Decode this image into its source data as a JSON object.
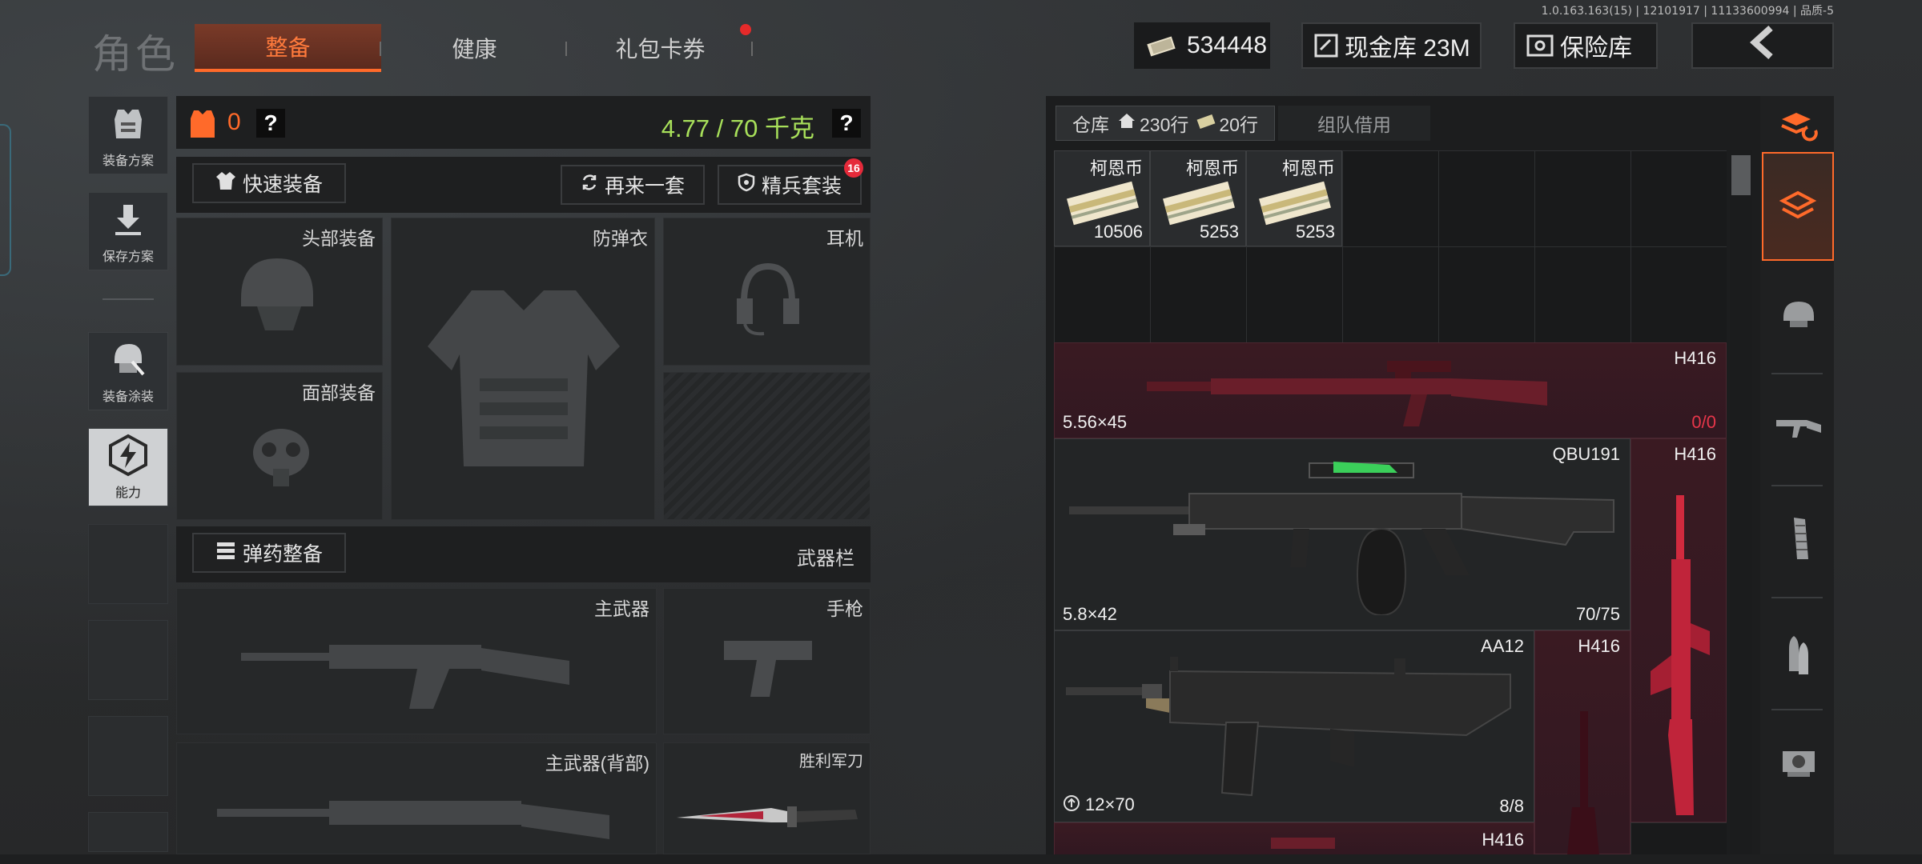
{
  "version": "1.0.163.163(15) | 12101917 | 11133600994 | 品质-5",
  "header": {
    "title": "角色",
    "tabs": [
      {
        "label": "整备",
        "active": true
      },
      {
        "label": "健康",
        "active": false
      },
      {
        "label": "礼包卡券",
        "active": false,
        "badge": true
      }
    ],
    "currency": "534448",
    "cash_vault": "现金库 23M",
    "safe": "保险库"
  },
  "left_nav": [
    {
      "label": "装备方案",
      "icon": "vest-icon"
    },
    {
      "label": "保存方案",
      "icon": "download-icon"
    },
    {
      "label": "装备涂装",
      "icon": "helmet-paint-icon"
    },
    {
      "label": "能力",
      "icon": "ability-icon"
    }
  ],
  "loadout": {
    "armor_count": "0",
    "weight": "4.77 / 70 千克",
    "quick_equip": "快速装备",
    "reroll": "再来一套",
    "elite_set": "精兵套装",
    "elite_badge": "16",
    "slots": {
      "head": "头部装备",
      "vest": "防弹衣",
      "headset": "耳机",
      "face": "面部装备",
      "ammo_btn": "弹药整备",
      "weapon_bar": "武器栏",
      "primary": "主武器",
      "pistol": "手枪",
      "primary_back": "主武器(背部)",
      "knife": "胜利军刀"
    }
  },
  "storage": {
    "tab_label": "仓库",
    "rows_home": "230行",
    "rows_extra": "20行",
    "team_tab": "组队借用",
    "coins": [
      {
        "name": "柯恩币",
        "count": "10506"
      },
      {
        "name": "柯恩币",
        "count": "5253"
      },
      {
        "name": "柯恩币",
        "count": "5253"
      }
    ],
    "weapons": [
      {
        "name": "H416",
        "caliber": "5.56×45",
        "ammo_a": "0",
        "ammo_b": "0"
      },
      {
        "name": "QBU191",
        "caliber": "5.8×42",
        "ammo": "70/75"
      },
      {
        "name": "H416"
      },
      {
        "name": "AA12",
        "caliber": "12×70",
        "ammo": "8/8"
      },
      {
        "name": "H416"
      },
      {
        "name": "H416"
      }
    ]
  },
  "colors": {
    "accent": "#ff6a2a",
    "weight": "#a8e05a",
    "danger": "#e8364a"
  }
}
